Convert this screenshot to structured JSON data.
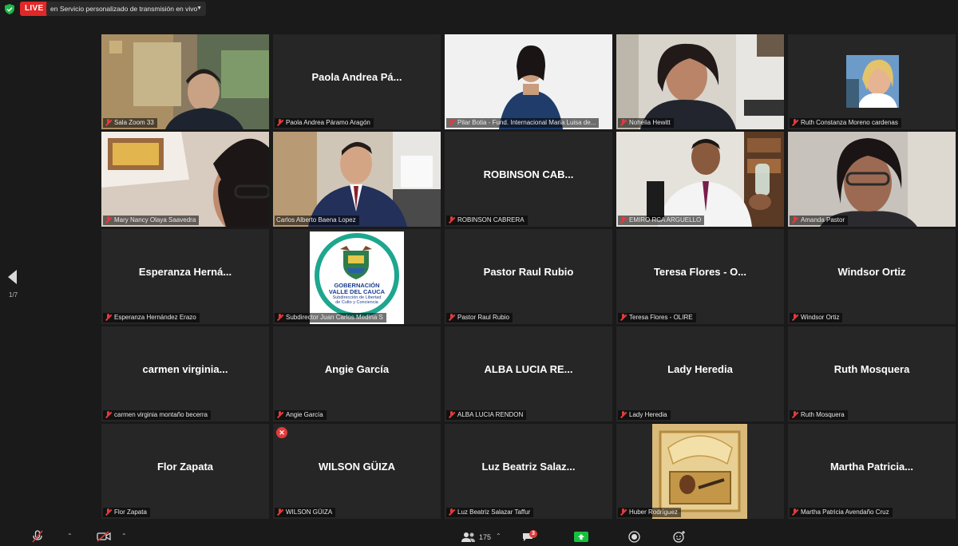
{
  "topbar": {
    "live_label": "LIVE",
    "stream_label": "en Servicio personalizado de transmisión en vivo"
  },
  "colors": {
    "live": "#e02828",
    "active_speaker_border": "#c8d86e",
    "muted_mic": "#e23b3b",
    "share_green": "#14c23c"
  },
  "tiles": [
    {
      "name": "Sala Zoom 33",
      "center": "",
      "video": true
    },
    {
      "name": "Paola Andrea Páramo Aragón",
      "center": "Paola Andrea Pá..."
    },
    {
      "name": "Pilar Botia - Fund. Internacional Maria Luisa de...",
      "center": "",
      "video": true
    },
    {
      "name": "Nohelia Hewitt",
      "center": "",
      "video": true
    },
    {
      "name": "Ruth Constanza Moreno cardenas",
      "center": "",
      "avatar": true
    },
    {
      "name": "Mary Nancy Olaya Saavedra",
      "center": "",
      "video": true
    },
    {
      "name": "Carlos Alberto Baena Lopez",
      "center": "",
      "video": true,
      "active": true
    },
    {
      "name": "ROBINSON CABRERA",
      "center": "ROBINSON CAB..."
    },
    {
      "name": "EMIRO RCA ARGUELLO",
      "center": "",
      "video": true
    },
    {
      "name": "Amanda Pastor",
      "center": "",
      "video": true
    },
    {
      "name": "Esperanza Hernández Erazo",
      "center": "Esperanza Herná..."
    },
    {
      "name": "Subdirector Juan Carlos Medina S",
      "center": "",
      "logo": true
    },
    {
      "name": "Pastor Raul Rubio",
      "center": "Pastor Raul Rubio"
    },
    {
      "name": "Teresa Flores - OLIRE",
      "center": "Teresa Flores - O..."
    },
    {
      "name": "Windsor Ortiz",
      "center": "Windsor Ortiz"
    },
    {
      "name": "carmen virginia montaño becerra",
      "center": "carmen  virginia..."
    },
    {
      "name": "Angie García",
      "center": "Angie García"
    },
    {
      "name": "ALBA LUCIA RENDON",
      "center": "ALBA  LUCIA  RE..."
    },
    {
      "name": "Lady Heredia",
      "center": "Lady Heredia"
    },
    {
      "name": "Ruth Mosquera",
      "center": "Ruth Mosquera"
    },
    {
      "name": "Flor Zapata",
      "center": "Flor Zapata"
    },
    {
      "name": "WILSON GÜIZA",
      "center": "WILSON GÜIZA",
      "video_off_badge": true
    },
    {
      "name": "Luz Beatriz Salazar Taffur",
      "center": "Luz Beatriz Salaz..."
    },
    {
      "name": "Huber Rodríguez",
      "center": "",
      "picture": true
    },
    {
      "name": "Martha Patricia Avendaño Cruz",
      "center": "Martha Patricia..."
    }
  ],
  "logo": {
    "line1": "GOBERNACIÓN",
    "line2": "VALLE DEL CAUCA",
    "line3": "Subdirección de Libertad",
    "line4": "de Culto y Conciencia"
  },
  "pager": {
    "indicator": "1/7"
  },
  "bottombar": {
    "participants_count": "175",
    "chat_badge": "3"
  },
  "icons": [
    "shield-icon",
    "mic-muted-icon",
    "video-off-icon",
    "participants-icon",
    "chat-icon",
    "share-screen-icon",
    "record-icon",
    "reactions-icon",
    "prev-page-icon"
  ]
}
